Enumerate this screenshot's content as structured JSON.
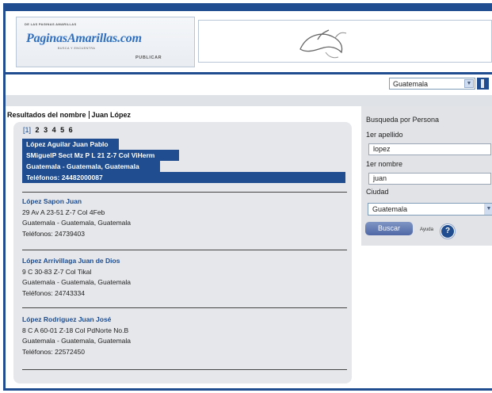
{
  "logo": {
    "small_text": "DE LAS PAGINAS AMARILLAS",
    "main_part1": "Paginas",
    "main_part2": "Amarillas",
    "main_part3": ".com",
    "tagline": "BUSCA Y ENCUENTRA",
    "publisher": "PUBLICAR"
  },
  "country_select": {
    "value": "Guatemala"
  },
  "results": {
    "title_label": "Resultados del nombre",
    "title_name": "Juan López",
    "pages": [
      "[1]",
      "2",
      "3",
      "4",
      "5",
      "6"
    ]
  },
  "entries": [
    {
      "name": "López Aguilar Juan Pablo",
      "address": "SMiguelP Sect Mz P L 21 Z-7 Col ViHerm",
      "location": "Guatemala -  Guatemala, Guatemala",
      "phone": "Teléfonos: 24482000087"
    },
    {
      "name": "López Sapon Juan",
      "address": "29 Av A 23-51 Z-7 Col 4Feb",
      "location": "Guatemala -  Guatemala, Guatemala",
      "phone": "Teléfonos: 24739403"
    },
    {
      "name": "López Arrivillaga Juan de Dios",
      "address": "9 C 30-83 Z-7 Col Tikal",
      "location": "Guatemala -  Guatemala, Guatemala",
      "phone": "Teléfonos: 24743334"
    },
    {
      "name": "López Rodriguez Juan José",
      "address": "8 C A 60-01 Z-18 Col PdNorte No.B",
      "location": "Guatemala -  Guatemala, Guatemala",
      "phone": "Teléfonos: 22572450"
    }
  ],
  "search_panel": {
    "title": "Busqueda por Persona",
    "surname_label": "1er apellido",
    "surname_value": "lopez",
    "firstname_label": "1er nombre",
    "firstname_value": "juan",
    "city_label": "Ciudad",
    "city_value": "Guatemala",
    "search_button": "Buscar",
    "help_label": "Ayuda",
    "help_glyph": "?"
  },
  "colors": {
    "accent": "#1f4d8f",
    "panel": "#e5e7ea"
  }
}
